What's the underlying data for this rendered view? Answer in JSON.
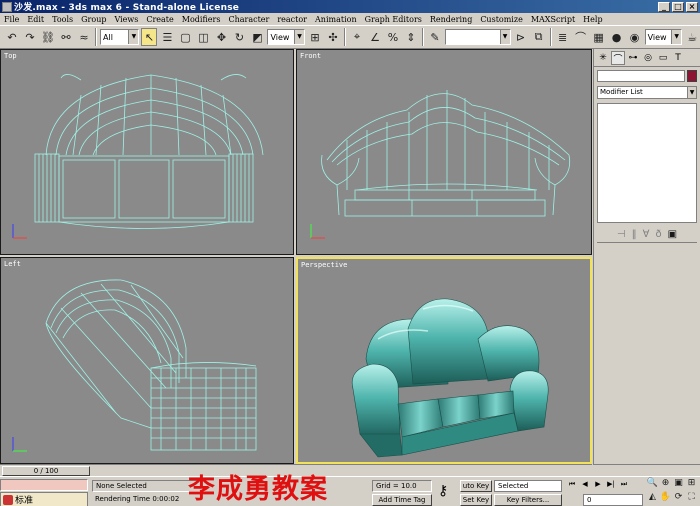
{
  "app": {
    "title": "沙发.max - 3ds max 6 - Stand-alone License"
  },
  "menu": [
    "File",
    "Edit",
    "Tools",
    "Group",
    "Views",
    "Create",
    "Modifiers",
    "Character",
    "reactor",
    "Animation",
    "Graph Editors",
    "Rendering",
    "Customize",
    "MAXScript",
    "Help"
  ],
  "toolbar": {
    "selection_filter": "All",
    "ref_coord": "View",
    "named_selection": "",
    "right_view": "View"
  },
  "viewports": {
    "top": "Top",
    "front": "Front",
    "left": "Left",
    "perspective": "Perspective"
  },
  "command_panel": {
    "object_name": "",
    "object_color": "#8b1533",
    "modifier_list": "Modifier List"
  },
  "time": {
    "slider": "0 / 100"
  },
  "status": {
    "selection": "None Selected",
    "render_time": "Rendering Time  0:00:02",
    "grid": "Grid = 10.0",
    "add_time_tag": "Add Time Tag",
    "auto_key": "uto Key",
    "set_key": "Set Key",
    "key_mode": "Selected",
    "key_filters": "Key Filters...",
    "frame": "0"
  },
  "ime": {
    "mode": "标准"
  },
  "watermark": "李成勇教案"
}
